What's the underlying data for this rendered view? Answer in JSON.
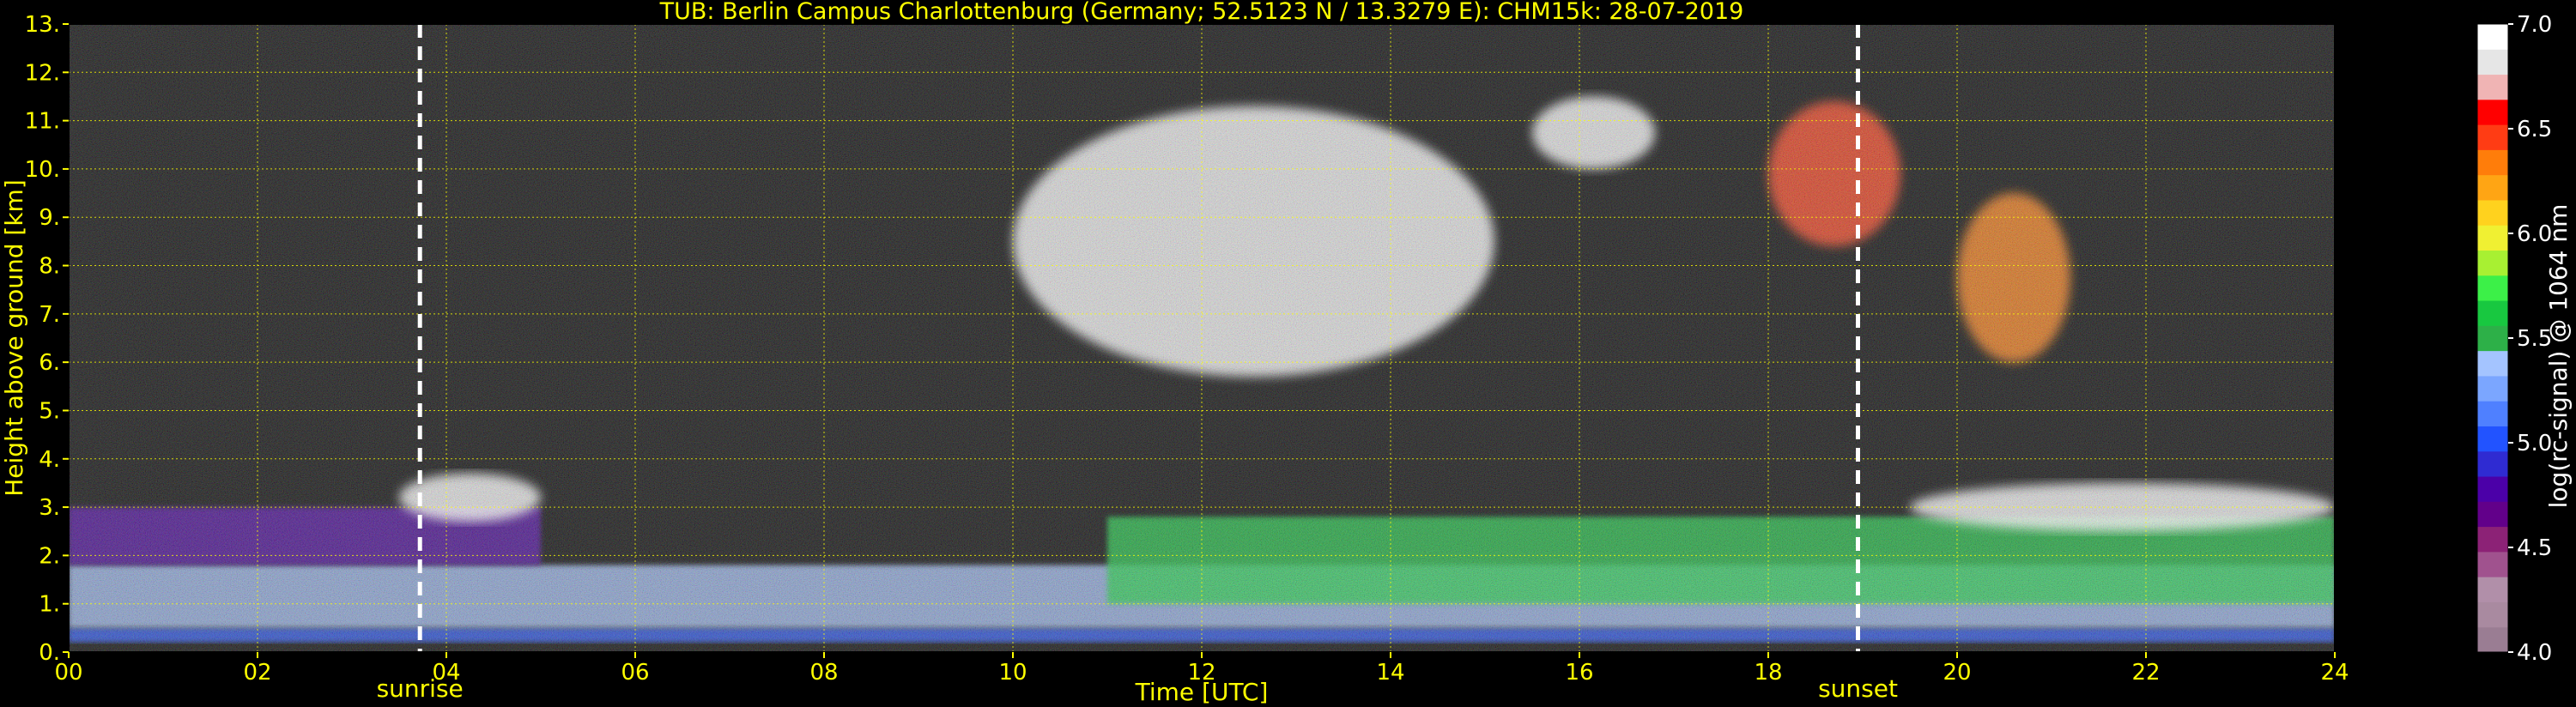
{
  "chart_data": {
    "type": "heatmap",
    "title": "TUB: Berlin Campus Charlottenburg (Germany; 52.5123 N / 13.3279 E):    CHM15k: 28-07-2019",
    "xlabel": "Time [UTC]",
    "ylabel": "Height above ground [km]",
    "xlim": [
      0,
      24
    ],
    "ylim": [
      0,
      13
    ],
    "x_ticks": [
      "00",
      "02",
      "04",
      "06",
      "08",
      "10",
      "12",
      "14",
      "16",
      "18",
      "20",
      "22",
      "24"
    ],
    "y_ticks": [
      "0.",
      "1.",
      "2.",
      "3.",
      "4.",
      "5.",
      "6.",
      "7.",
      "8.",
      "9.",
      "10.",
      "11.",
      "12.",
      "13."
    ],
    "grid": true,
    "colorbar": {
      "label": "log(rc-signal) @ 1064 nm",
      "range": [
        4.0,
        7.0
      ],
      "ticks": [
        "4.0",
        "4.5",
        "5.0",
        "5.5",
        "6.0",
        "6.5",
        "7.0"
      ],
      "colors": [
        "#9a7d93",
        "#a98aa0",
        "#b18fa9",
        "#a0528e",
        "#8c2276",
        "#62008a",
        "#4b00a8",
        "#2f2bd2",
        "#2253ff",
        "#4f80ff",
        "#7ba6ff",
        "#a4c4ff",
        "#2db048",
        "#18c840",
        "#3cf048",
        "#a8f032",
        "#f0f032",
        "#ffd21e",
        "#ffa514",
        "#ff7d0a",
        "#ff3c14",
        "#ff0000",
        "#f0b4b4",
        "#e6e6e6",
        "#ffffff"
      ]
    },
    "annotations": [
      {
        "label": "sunrise",
        "x": 3.72
      },
      {
        "label": "sunset",
        "x": 18.95
      }
    ],
    "layers": [
      {
        "feature": "surface aerosol layer",
        "x": [
          0,
          24
        ],
        "y": [
          0.2,
          0.5
        ],
        "log_signal": 5.0
      },
      {
        "feature": "boundary layer aerosol",
        "x": [
          0,
          24
        ],
        "y": [
          0.5,
          1.8
        ],
        "log_signal": 5.4
      },
      {
        "feature": "residual layer",
        "x": [
          0,
          5
        ],
        "y": [
          1.8,
          3.0
        ],
        "log_signal": 4.8
      },
      {
        "feature": "convective boundary layer",
        "x": [
          11,
          24
        ],
        "y": [
          1.0,
          2.8
        ],
        "log_signal": 5.6
      },
      {
        "feature": "PBL top clouds",
        "x": [
          3.5,
          5
        ],
        "y": [
          2.7,
          3.7
        ],
        "log_signal": 7.0
      },
      {
        "feature": "PBL top clouds",
        "x": [
          19.5,
          24
        ],
        "y": [
          2.5,
          3.5
        ],
        "log_signal": 7.0
      },
      {
        "feature": "cirrus clouds",
        "x": [
          10,
          15.1
        ],
        "y": [
          5.7,
          11.3
        ],
        "log_signal": 7.0
      },
      {
        "feature": "cirrus clouds",
        "x": [
          15.5,
          16.8
        ],
        "y": [
          10.0,
          11.5
        ],
        "log_signal": 7.0
      },
      {
        "feature": "cirrus clouds",
        "x": [
          18,
          19.4
        ],
        "y": [
          8.4,
          11.4
        ],
        "log_signal": 6.5
      },
      {
        "feature": "cirrus clouds",
        "x": [
          20,
          21.2
        ],
        "y": [
          6.0,
          9.5
        ],
        "log_signal": 6.3
      }
    ]
  }
}
